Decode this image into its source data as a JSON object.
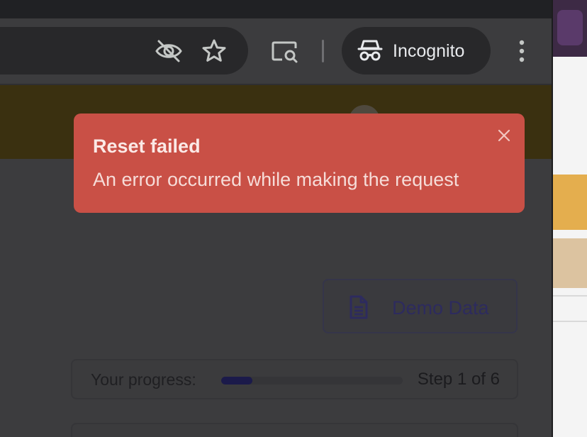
{
  "browser": {
    "incognito_label": "Incognito",
    "icons": [
      "eye-off-icon",
      "star-icon",
      "cast-search-icon",
      "incognito-icon",
      "more-vert-icon"
    ]
  },
  "toast": {
    "title": "Reset failed",
    "message": "An error occurred while making the request",
    "color": "#c95046"
  },
  "demo_button": {
    "label": "Demo Data"
  },
  "progress": {
    "label": "Your progress:",
    "step_text": "Step 1 of 6",
    "fraction": 0.17
  }
}
